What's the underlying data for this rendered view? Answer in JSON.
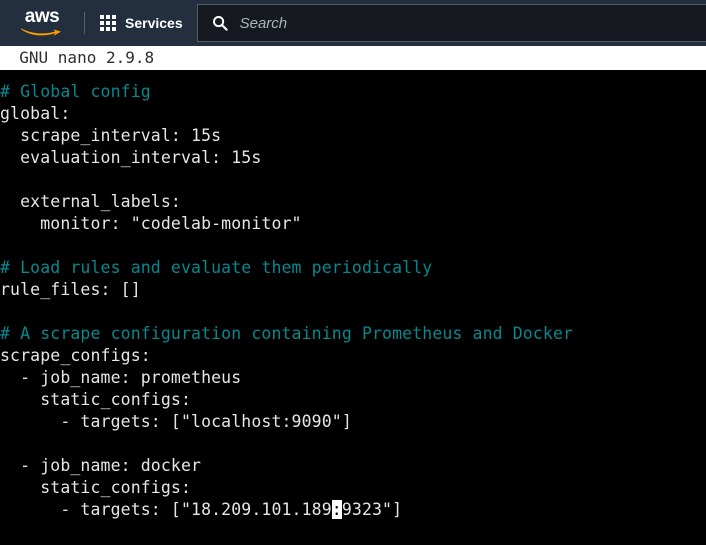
{
  "header": {
    "logo_text": "aws",
    "logo_name": "aws-logo",
    "services_label": "Services",
    "grid_icon_name": "app-grid-icon",
    "search": {
      "placeholder": "Search",
      "value": "",
      "icon_name": "search-icon"
    },
    "background_color": "#232f3e",
    "accent_color": "#ff9900"
  },
  "terminal": {
    "titlebar": "  GNU nano 2.9.8",
    "editor_name": "GNU nano",
    "version": "2.9.8",
    "background_color": "#000000",
    "text_color": "#e6e6e6",
    "comment_color": "#06888e",
    "cursor_char": ":",
    "lines": [
      {
        "segments": [
          {
            "text": "# Global config",
            "style": "comment"
          }
        ]
      },
      {
        "segments": [
          {
            "text": "global:",
            "style": "plain"
          }
        ]
      },
      {
        "segments": [
          {
            "text": "  scrape_interval: 15s",
            "style": "plain"
          }
        ]
      },
      {
        "segments": [
          {
            "text": "  evaluation_interval: 15s",
            "style": "plain"
          }
        ]
      },
      {
        "segments": [
          {
            "text": "",
            "style": "plain"
          }
        ]
      },
      {
        "segments": [
          {
            "text": "  external_labels:",
            "style": "plain"
          }
        ]
      },
      {
        "segments": [
          {
            "text": "    monitor: \"codelab-monitor\"",
            "style": "plain"
          }
        ]
      },
      {
        "segments": [
          {
            "text": "",
            "style": "plain"
          }
        ]
      },
      {
        "segments": [
          {
            "text": "# Load rules and evaluate them periodically",
            "style": "comment"
          }
        ]
      },
      {
        "segments": [
          {
            "text": "rule_files: []",
            "style": "plain"
          }
        ]
      },
      {
        "segments": [
          {
            "text": "",
            "style": "plain"
          }
        ]
      },
      {
        "segments": [
          {
            "text": "# A scrape configuration containing Prometheus and Docker",
            "style": "comment"
          }
        ]
      },
      {
        "segments": [
          {
            "text": "scrape_configs:",
            "style": "plain"
          }
        ]
      },
      {
        "segments": [
          {
            "text": "  - job_name: prometheus",
            "style": "plain"
          }
        ]
      },
      {
        "segments": [
          {
            "text": "    static_configs:",
            "style": "plain"
          }
        ]
      },
      {
        "segments": [
          {
            "text": "      - targets: [\"localhost:9090\"]",
            "style": "plain"
          }
        ]
      },
      {
        "segments": [
          {
            "text": "",
            "style": "plain"
          }
        ]
      },
      {
        "segments": [
          {
            "text": "  - job_name: docker",
            "style": "plain"
          }
        ]
      },
      {
        "segments": [
          {
            "text": "    static_configs:",
            "style": "plain"
          }
        ]
      },
      {
        "segments": [
          {
            "text": "      - targets: [\"18.209.101.189",
            "style": "plain"
          },
          {
            "text": ":",
            "style": "cursor"
          },
          {
            "text": "9323\"]",
            "style": "plain"
          }
        ]
      }
    ]
  }
}
